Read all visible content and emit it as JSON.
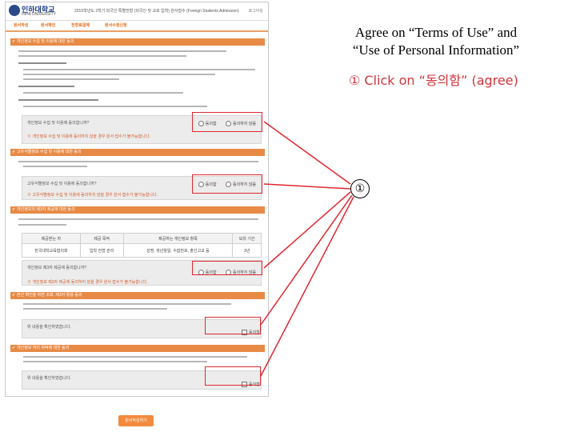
{
  "header": {
    "logo_text": "인하대학교",
    "logo_sub": "INHA UNIVERSITY",
    "page_title": "2015학년도 2학기 외국인 특별전형 (외국인 및 교포 입학) 원서접수 (Foreign Students Admission)",
    "right_link": "로그아웃"
  },
  "tabs": [
    "원서작성",
    "원서확인",
    "전형료결제",
    "원서수정신청"
  ],
  "sections": [
    {
      "title": "개인정보 수집 및 이용에 대한 동의"
    },
    {
      "title": "고유식별정보 수집 및 이용에 대한 동의"
    },
    {
      "title": "개인정보의 제3자 제공에 대한 동의"
    },
    {
      "title": "본인 확인을 위한 조회, 제3자 활용 동의"
    },
    {
      "title": "개인정보 처리 위탁에 대한 동의"
    }
  ],
  "consent": {
    "question": "개인정보 수집 및 이용에 동의합니까?",
    "agree": "동의함",
    "disagree": "동의하지 않음",
    "note": "※ 개인정보 수집 및 이용에 동의하지 않을 경우 원서 접수가 불가능합니다."
  },
  "consent2": {
    "question": "고유식별정보 수집 및 이용에 동의합니까?",
    "agree": "동의함",
    "disagree": "동의하지 않음",
    "note": "※ 고유식별정보 수집 및 이용에 동의하지 않을 경우 원서 접수가 불가능합니다."
  },
  "table": {
    "headers": [
      "제공받는 자",
      "제공 목적",
      "제공하는 개인정보 항목",
      "보유 기간"
    ],
    "row": [
      "한국대학교육협의회",
      "입학 전형 관리",
      "성명, 생년월일, 수험번호, 출신고교 등",
      "3년"
    ]
  },
  "consent3": {
    "question": "개인정보 제3자 제공에 동의합니까?",
    "agree": "동의함",
    "disagree": "동의하지 않음",
    "note": "※ 개인정보 제3자 제공에 동의하지 않을 경우 원서 접수가 불가능합니다."
  },
  "check1": {
    "question": "위 내용을 확인하였습니다.",
    "label": "동의함"
  },
  "check2": {
    "question": "위 내용을 확인하였습니다.",
    "label": "동의함"
  },
  "submit_label": "원서작성하기",
  "callout": {
    "line1": "Agree on “Terms of Use” and",
    "line2": "“Use of Personal Information”",
    "step": "① Click on “동의함” (agree)",
    "badge": "①"
  },
  "colors": {
    "accent": "#e88a45",
    "highlight": "#e0282f"
  }
}
